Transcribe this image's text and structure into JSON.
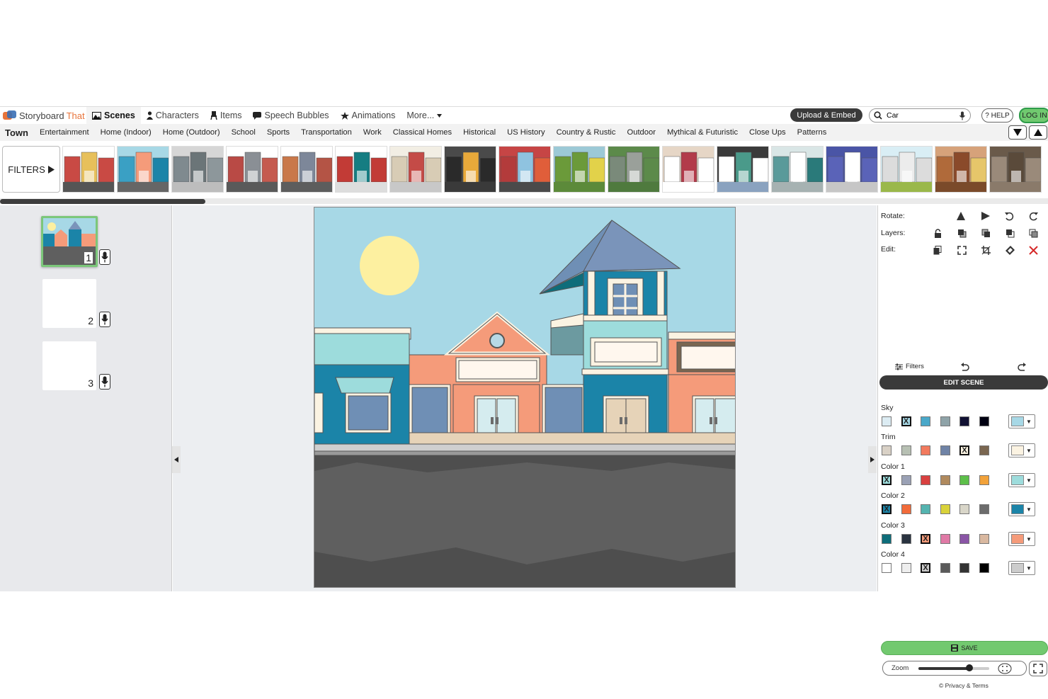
{
  "app": {
    "logo_word1": "Storyboard",
    "logo_word2": "That"
  },
  "nav": {
    "items": [
      {
        "label": "Scenes",
        "icon": "image-icon",
        "active": true
      },
      {
        "label": "Characters",
        "icon": "person-icon"
      },
      {
        "label": "Items",
        "icon": "chair-icon"
      },
      {
        "label": "Speech Bubbles",
        "icon": "speech-bubble-icon"
      },
      {
        "label": "Animations",
        "icon": "animation-star-icon"
      },
      {
        "label": "More...",
        "icon": "caret-down-icon"
      }
    ],
    "upload_label": "Upload & Embed",
    "search_value": "Car",
    "help_label": "? HELP",
    "login_label": "LOG IN"
  },
  "categories": {
    "title": "Town",
    "items": [
      "Entertainment",
      "Home (Indoor)",
      "Home (Outdoor)",
      "School",
      "Sports",
      "Transportation",
      "Work",
      "Classical Homes",
      "Historical",
      "US History",
      "Country & Rustic",
      "Outdoor",
      "Mythical & Futuristic",
      "Close Ups",
      "Patterns"
    ]
  },
  "filters_label": "FILTERS",
  "thumbnails": [
    {
      "sky": "#ffffff",
      "ground": "#555555",
      "b": [
        "#c94a44",
        "#e7c05b",
        "#c94a44"
      ]
    },
    {
      "sky": "#a7d8e6",
      "ground": "#666666",
      "b": [
        "#3aa0c4",
        "#f59b7a",
        "#1b84a8"
      ]
    },
    {
      "sky": "#d6d6d6",
      "ground": "#bdbdbd",
      "b": [
        "#7f8a8f",
        "#6b7578",
        "#8d979b"
      ]
    },
    {
      "sky": "#ffffff",
      "ground": "#5a5a5a",
      "b": [
        "#b94a45",
        "#8a8f95",
        "#c55a4f"
      ]
    },
    {
      "sky": "#ffffff",
      "ground": "#5d5d5d",
      "b": [
        "#c9784a",
        "#7d8799",
        "#b45445"
      ]
    },
    {
      "sky": "#ffffff",
      "ground": "#dddddd",
      "b": [
        "#c23b36",
        "#157d82",
        "#c23b36"
      ]
    },
    {
      "sky": "#f2eee4",
      "ground": "#c8c8c8",
      "b": [
        "#d8ccb5",
        "#c44b47",
        "#d8ccb5"
      ]
    },
    {
      "sky": "#4a4a4a",
      "ground": "#3a3a3a",
      "b": [
        "#2a2a2a",
        "#e8a93a",
        "#2a2a2a"
      ]
    },
    {
      "sky": "#c64545",
      "ground": "#4a4a4a",
      "b": [
        "#b33b3b",
        "#8fc3e0",
        "#e05e3a"
      ]
    },
    {
      "sky": "#9cc9d6",
      "ground": "#5c8a3a",
      "b": [
        "#6b9a3a",
        "#6b9a3a",
        "#e2d24a"
      ]
    },
    {
      "sky": "#5c8a4a",
      "ground": "#4f7a3e",
      "b": [
        "#7a8a7a",
        "#9aa09a",
        "#5c8a4a"
      ]
    },
    {
      "sky": "#e6d6c6",
      "ground": "#ffffff",
      "b": [
        "#ffffff",
        "#b23b4a",
        "#ffffff"
      ]
    },
    {
      "sky": "#3a3a3a",
      "ground": "#8aa2bf",
      "b": [
        "#ffffff",
        "#4a9a8a",
        "#ffffff"
      ]
    },
    {
      "sky": "#d9e6e6",
      "ground": "#a6b2b2",
      "b": [
        "#5a9a9a",
        "#ffffff",
        "#2a7a7a"
      ]
    },
    {
      "sky": "#4a55a6",
      "ground": "#c6c6c6",
      "b": [
        "#5a63b8",
        "#ffffff",
        "#5a63b8"
      ]
    },
    {
      "sky": "#d9eef5",
      "ground": "#9ab84a",
      "b": [
        "#dcdcdc",
        "#ececec",
        "#dcdcdc"
      ]
    },
    {
      "sky": "#d6a27a",
      "ground": "#7a4a2a",
      "b": [
        "#b06a3a",
        "#8a4a2a",
        "#e6c66a"
      ]
    },
    {
      "sky": "#6a5a4a",
      "ground": "#8a7a6a",
      "b": [
        "#9a8a7a",
        "#5a4a3a",
        "#9a8a7a"
      ]
    }
  ],
  "cells": [
    {
      "number": "1"
    },
    {
      "number": "2"
    },
    {
      "number": "3"
    }
  ],
  "toolbar": {
    "rotate_label": "Rotate:",
    "layers_label": "Layers:",
    "edit_label": "Edit:",
    "filters_label": "Filters"
  },
  "edit_scene_label": "EDIT SCENE",
  "color_groups": [
    {
      "label": "Sky",
      "swatches": [
        "#dcecf3",
        "#a7d8e6",
        "#4aa8c9",
        "#8fa3a8",
        "#111133",
        "#000011"
      ],
      "selected": 1,
      "current": "#a7d8e6"
    },
    {
      "label": "Trim",
      "swatches": [
        "#d9d1c6",
        "#b7c0b3",
        "#f27a5e",
        "#6f83a6",
        "#fbf3e2",
        "#7a6650"
      ],
      "selected": 4,
      "current": "#fbf3e2"
    },
    {
      "label": "Color 1",
      "swatches": [
        "#9ddcdc",
        "#9aa1b5",
        "#d94140",
        "#b08a5e",
        "#5dbf4a",
        "#f2a23a"
      ],
      "selected": 0,
      "current": "#9ddcdc"
    },
    {
      "label": "Color 2",
      "swatches": [
        "#1b84a8",
        "#f26b3a",
        "#54b4b0",
        "#d9d23a",
        "#d9d6c9",
        "#6c6c6c"
      ],
      "selected": 0,
      "current": "#1b84a8"
    },
    {
      "label": "Color 3",
      "swatches": [
        "#0e6d7a",
        "#2a3340",
        "#f59b7a",
        "#e07aa6",
        "#8a55a6",
        "#d9b8a0"
      ],
      "selected": 2,
      "current": "#f59b7a"
    },
    {
      "label": "Color 4",
      "swatches": [
        "#ffffff",
        "#eeeeee",
        "#cccccc",
        "#5a5a5a",
        "#333333",
        "#000000"
      ],
      "selected": 2,
      "current": "#cccccc"
    }
  ],
  "save_label": "SAVE",
  "zoom_label": "Zoom",
  "zoom_level": 0.72,
  "privacy_label": "© Privacy & Terms"
}
